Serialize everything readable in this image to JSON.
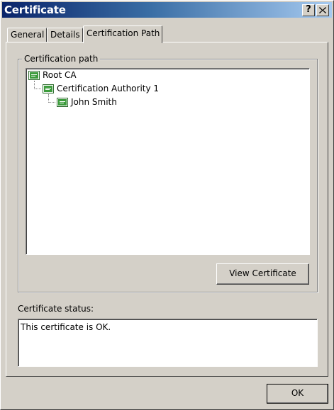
{
  "window": {
    "title": "Certificate",
    "help_button": "?",
    "close_button": "X"
  },
  "tabs": [
    {
      "label": "General",
      "selected": false
    },
    {
      "label": "Details",
      "selected": false
    },
    {
      "label": "Certification Path",
      "selected": true
    }
  ],
  "certification_path": {
    "group_label": "Certification path",
    "tree": [
      {
        "label": "Root CA",
        "level": 0,
        "icon": "certificate-icon"
      },
      {
        "label": "Certification Authority 1",
        "level": 1,
        "icon": "certificate-icon"
      },
      {
        "label": "John Smith",
        "level": 2,
        "icon": "certificate-icon"
      }
    ],
    "view_button": "View Certificate"
  },
  "status": {
    "label": "Certificate status:",
    "text": "This certificate is OK."
  },
  "footer": {
    "ok_button": "OK"
  },
  "colors": {
    "titlebar_start": "#0a246a",
    "titlebar_end": "#a6caf0",
    "face": "#d4d0c8",
    "certificate_icon": "#2e8b2e"
  }
}
